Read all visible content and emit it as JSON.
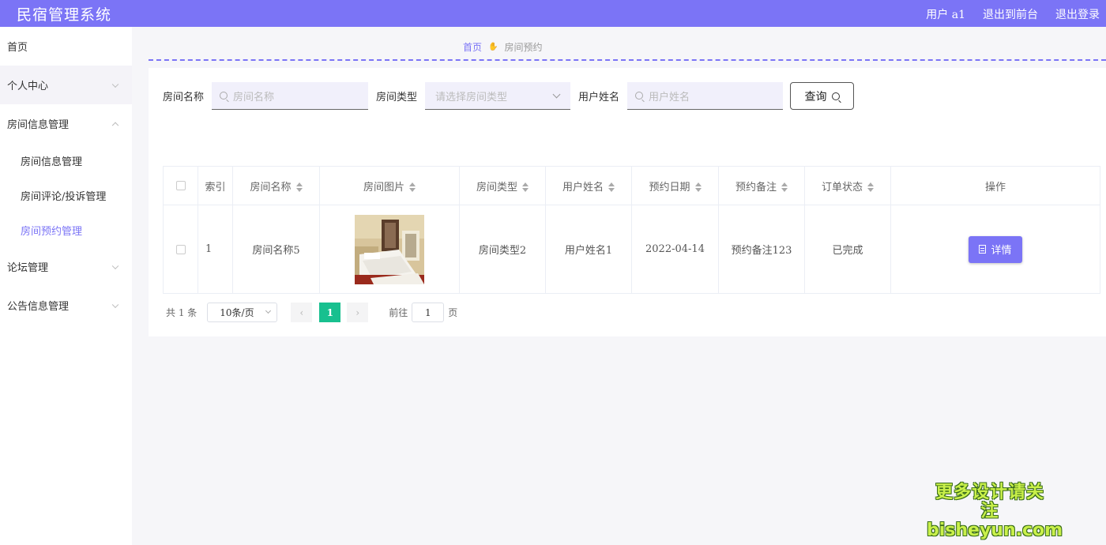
{
  "header": {
    "title": "民宿管理系统",
    "user": "用户 a1",
    "back_front": "退出到前台",
    "logout": "退出登录"
  },
  "sidebar": {
    "home": "首页",
    "personal": "个人中心",
    "room_info_group": "房间信息管理",
    "sub_items": [
      "房间信息管理",
      "房间评论/投诉管理",
      "房间预约管理"
    ],
    "forum": "论坛管理",
    "notice": "公告信息管理"
  },
  "breadcrumb": {
    "home": "首页",
    "current": "房间预约"
  },
  "search": {
    "room_name_label": "房间名称",
    "room_name_placeholder": "房间名称",
    "room_type_label": "房间类型",
    "room_type_placeholder": "请选择房间类型",
    "user_name_label": "用户姓名",
    "user_name_placeholder": "用户姓名",
    "query_button": "查询"
  },
  "table": {
    "headers": [
      "索引",
      "房间名称",
      "房间图片",
      "房间类型",
      "用户姓名",
      "预约日期",
      "预约备注",
      "订单状态",
      "操作"
    ],
    "rows": [
      {
        "index": "1",
        "room_name": "房间名称5",
        "room_type": "房间类型2",
        "user_name": "用户姓名1",
        "date": "2022-04-14",
        "remark": "预约备注123",
        "status": "已完成",
        "action": "详情"
      }
    ]
  },
  "pagination": {
    "total": "共 1 条",
    "page_size": "10条/页",
    "current_page": "1",
    "goto_label": "前往",
    "goto_value": "1",
    "page_suffix": "页"
  },
  "watermark": {
    "line1": "更多设计请关注",
    "line2": "bisheyun.com"
  },
  "colors": {
    "accent": "#7b74f6",
    "pager_active": "#18c08f"
  }
}
